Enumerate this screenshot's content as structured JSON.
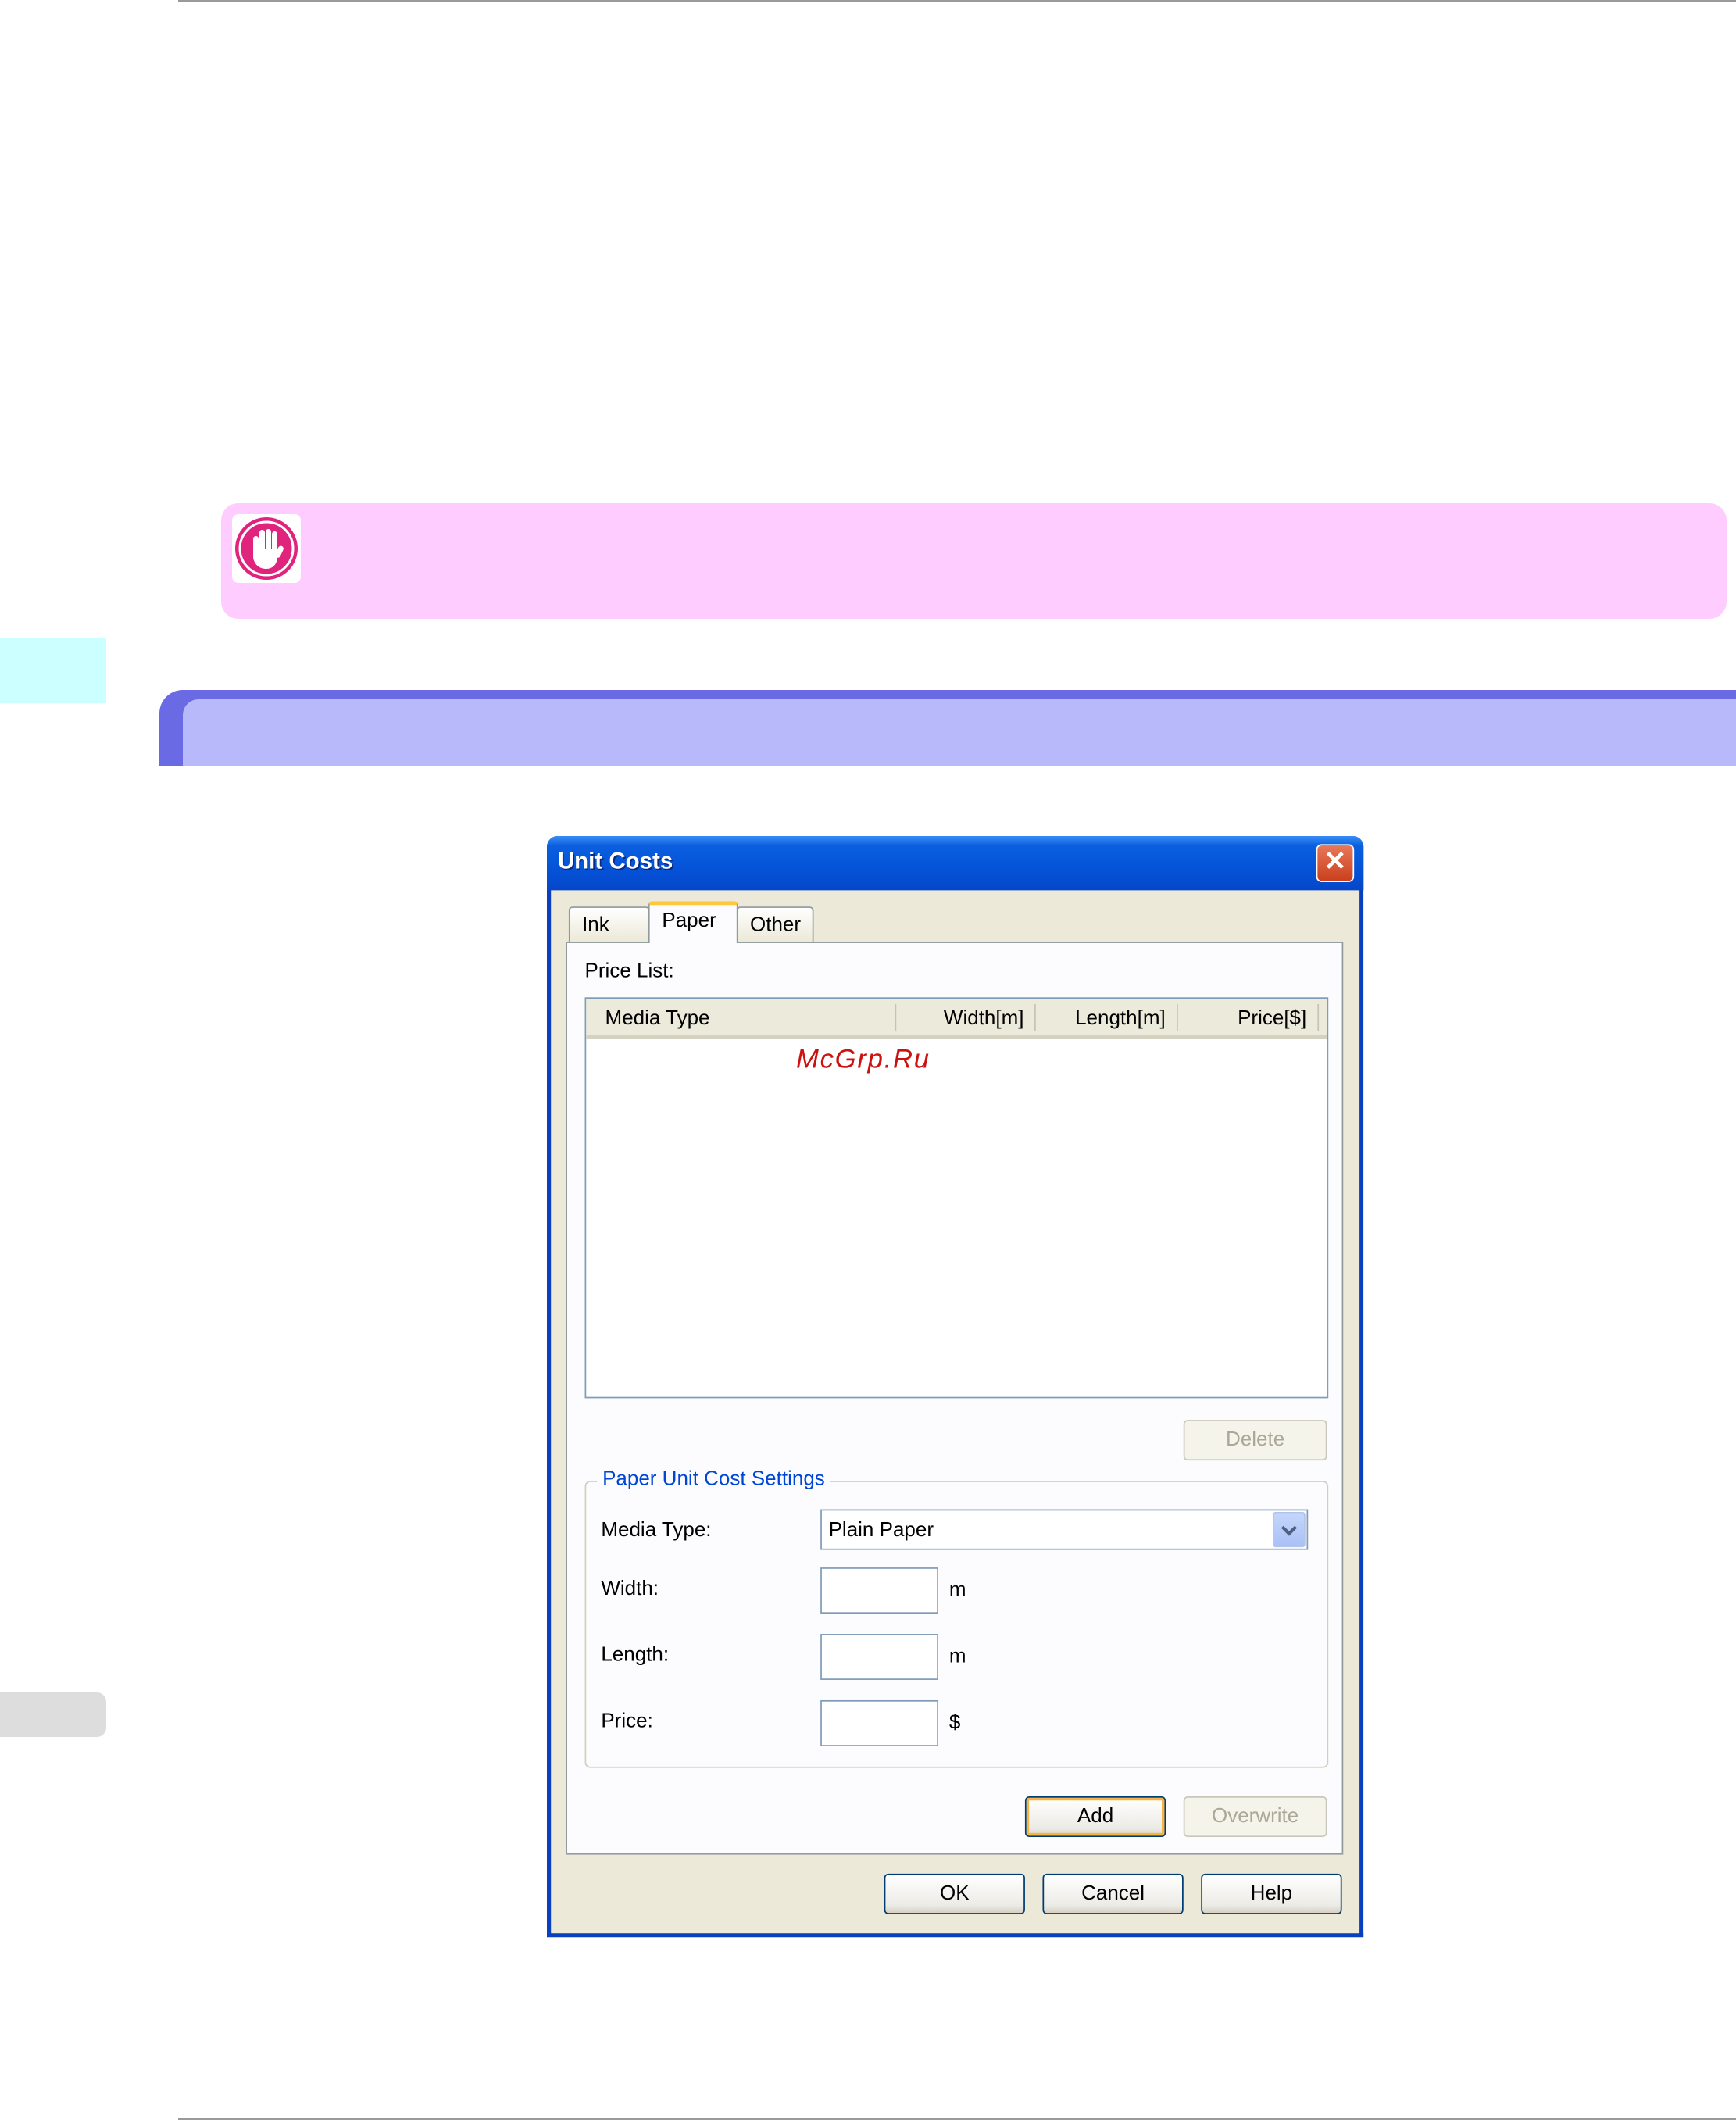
{
  "dialog": {
    "title": "Unit Costs",
    "close_glyph": "✕",
    "tabs": {
      "ink": "Ink",
      "paper": "Paper",
      "other": "Other"
    },
    "price_list_label": "Price List:",
    "columns": {
      "media_type": "Media Type",
      "width": "Width[m]",
      "length": "Length[m]",
      "price": "Price[$]"
    },
    "delete_label": "Delete",
    "group_title": "Paper Unit Cost Settings",
    "media_type_label": "Media Type:",
    "media_type_value": "Plain Paper",
    "width_label": "Width:",
    "width_unit": "m",
    "length_label": "Length:",
    "length_unit": "m",
    "price_label": "Price:",
    "price_unit": "$",
    "add_label": "Add",
    "overwrite_label": "Overwrite",
    "ok_label": "OK",
    "cancel_label": "Cancel",
    "help_label": "Help"
  },
  "watermark": "McGrp.Ru",
  "colors": {
    "important_bg": "#ffccff",
    "important_icon": "#e0247e",
    "section_header": "#6a6be4",
    "section_header_inner": "#b8b9fb",
    "xp_titlebar": "#0553d8"
  },
  "icons": {
    "important": "hand-stop-icon",
    "dropdown": "chevron-down-icon",
    "close": "close-icon"
  }
}
